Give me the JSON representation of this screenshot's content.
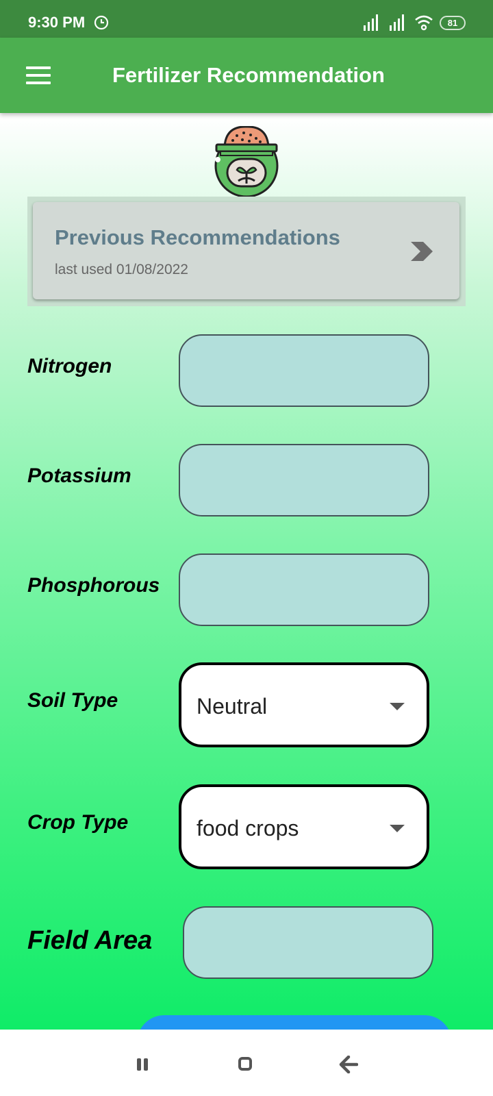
{
  "status_bar": {
    "time": "9:30 PM",
    "battery": "81"
  },
  "app_bar": {
    "title": "Fertilizer Recommendation"
  },
  "previous": {
    "title": "Previous Recommendations",
    "subtitle": "last used 01/08/2022"
  },
  "form": {
    "nitrogen_label": "Nitrogen",
    "potassium_label": "Potassium",
    "phosphorous_label": "Phosphorous",
    "soil_type_label": "Soil Type",
    "soil_type_value": "Neutral",
    "crop_type_label": "Crop Type",
    "crop_type_value": "food crops",
    "field_area_label": "Field Area"
  },
  "colors": {
    "status_bar": "#3d8a3f",
    "app_bar": "#4caf50",
    "input_fill": "#b2dfdb",
    "button": "#2196f3"
  }
}
